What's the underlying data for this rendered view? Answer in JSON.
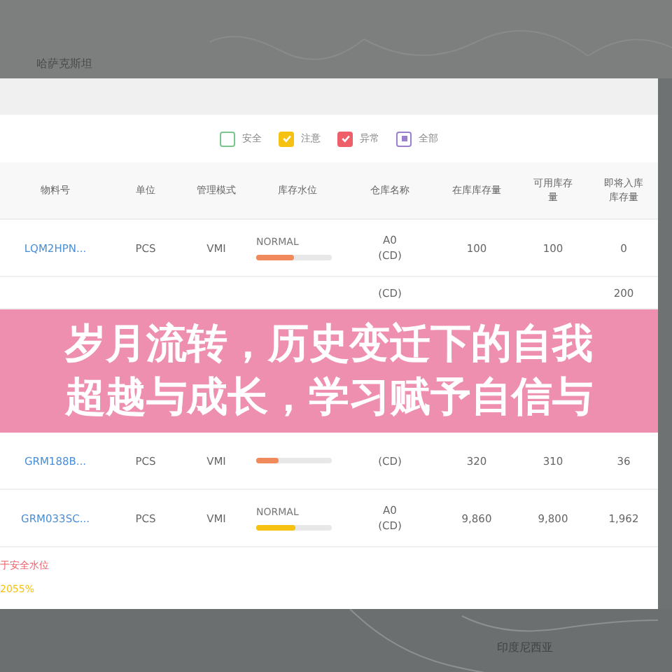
{
  "map_labels": {
    "top": "哈萨克斯坦",
    "bottom": "印度尼西亚"
  },
  "legend": [
    {
      "label": "安全",
      "kind": "tick",
      "checked": false,
      "color": "#7cc58f"
    },
    {
      "label": "注意",
      "kind": "tick",
      "checked": true,
      "color": "#f5c211"
    },
    {
      "label": "异常",
      "kind": "tick",
      "checked": true,
      "color": "#ee5f6a"
    },
    {
      "label": "全部",
      "kind": "mixed",
      "checked": true,
      "color": "#9b7fd1"
    }
  ],
  "table": {
    "columns": [
      "物料号",
      "单位",
      "管理模式",
      "库存水位",
      "仓库名称",
      "在库库存量",
      "可用库存量",
      "即将入库库存量"
    ],
    "rows": [
      {
        "material": "LQM2HPN...",
        "unit": "PCS",
        "mode": "VMI",
        "status": "NORMAL",
        "level": 0.5,
        "color": "#f08a5d",
        "warehouse": "A0",
        "warehouse_code": "(CD)",
        "on_hand": "100",
        "available": "100",
        "incoming": "0"
      },
      {
        "warehouse_code": "(CD)",
        "incoming": "200"
      },
      {
        "material": "GRM188B...",
        "unit": "PCS",
        "mode": "VMI",
        "level": 0.3,
        "color": "#f08a5d",
        "warehouse_code": "(CD)",
        "on_hand": "320",
        "available": "310",
        "incoming": "36"
      },
      {
        "material": "GRM033SC...",
        "unit": "PCS",
        "mode": "VMI",
        "status": "NORMAL",
        "level": 0.52,
        "color": "#f5c211",
        "warehouse": "A0",
        "warehouse_code": "(CD)",
        "on_hand": "9,860",
        "available": "9,800",
        "incoming": "1,962"
      }
    ]
  },
  "banner": {
    "title": "岁月流转，历史变迁下的自我超越与成长，学习赋予自信与"
  },
  "notes": [
    {
      "text": "于安全水位",
      "color": "#ee5f6a"
    },
    {
      "text": "2055%",
      "color": "#f5c211"
    }
  ]
}
